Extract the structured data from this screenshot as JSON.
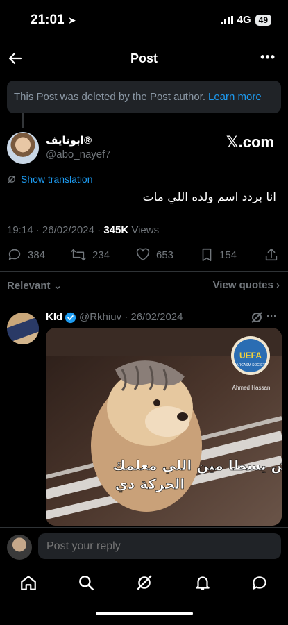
{
  "status_bar": {
    "time": "21:01",
    "network": "4G",
    "battery": "49"
  },
  "header": {
    "title": "Post"
  },
  "notice": {
    "text": "This Post was deleted by the Post author.",
    "link": "Learn more"
  },
  "post": {
    "author_name": "ابونايف®",
    "author_handle": "@abo_nayef7",
    "source_badge": "𝕏.com",
    "translation_label": "Show translation",
    "text": "انا بردد اسم ولده اللي مات",
    "time": "19:14",
    "date": "26/02/2024",
    "views_count": "345K",
    "views_label": "Views",
    "replies": "384",
    "reposts": "234",
    "likes": "653",
    "bookmarks": "154"
  },
  "sort": {
    "label": "Relevant",
    "view_quotes": "View quotes"
  },
  "reply": {
    "name": "Kld",
    "handle": "@Rkhiuv",
    "date": "26/02/2024",
    "image": {
      "caption_line1": "عاش يسطا مين اللي معلمك",
      "caption_line2": "الحركة دي",
      "logo_text": "UEFA",
      "logo_sub": "SARCASM SOCIETY",
      "credit": "Ahmed Hassan"
    }
  },
  "composer": {
    "placeholder": "Post your reply"
  },
  "icons": {
    "back": "arrow-left-icon",
    "more": "more-icon",
    "grok": "grok-icon",
    "reply": "reply-icon",
    "repost": "repost-icon",
    "like": "heart-icon",
    "bookmark": "bookmark-icon",
    "share": "share-icon",
    "home": "home-icon",
    "search": "search-icon",
    "notifications": "bell-icon",
    "messages": "message-icon"
  },
  "colors": {
    "accent": "#1d9bf0",
    "background": "#000000",
    "muted": "#71767b"
  }
}
